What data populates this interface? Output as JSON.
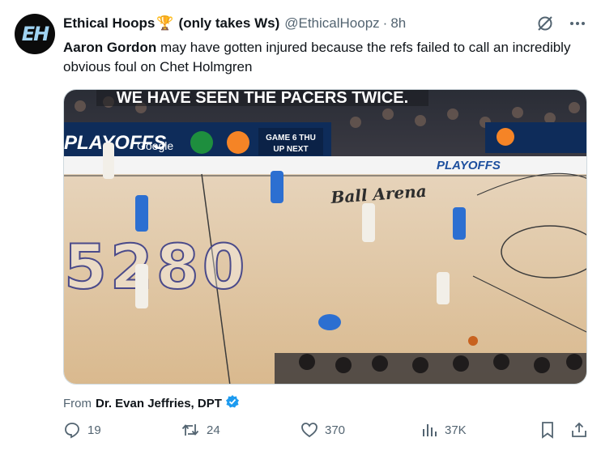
{
  "tweet": {
    "avatar_initials": "EH",
    "display_name": "Ethical Hoops",
    "trophy_emoji": "🏆",
    "display_name_suffix": "(only takes Ws)",
    "handle": "@EthicalHoopz",
    "separator": "·",
    "time": "8h",
    "mention": "Aaron Gordon",
    "text": " may have gotten injured because the refs failed to call an incredibly obvious foul on Chet Holmgren"
  },
  "media": {
    "caption_overlay": "WE HAVE SEEN THE PACERS TWICE.",
    "court_number": "5280",
    "arena_text": "Ball Arena",
    "banner_left": "PLAYOFFS",
    "banner_google": "Google",
    "banner_right": "PLAYOFFS",
    "banner_game": "GAME 6 THU",
    "banner_game2": "UP NEXT"
  },
  "source": {
    "prefix": "From",
    "name": "Dr. Evan Jeffries, DPT"
  },
  "actions": {
    "replies": "19",
    "reposts": "24",
    "likes": "370",
    "views": "37K"
  },
  "colors": {
    "text": "#0f1419",
    "secondary": "#536471",
    "verified": "#1d9bf0"
  }
}
